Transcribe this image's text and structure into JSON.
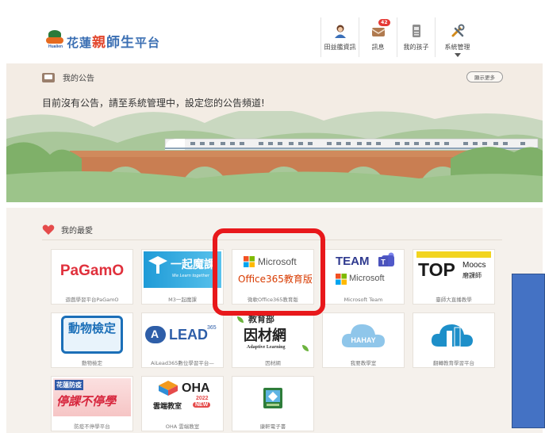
{
  "header": {
    "logo": {
      "text1": "花蓮",
      "text2": "親",
      "text3": "師生",
      "text4": "平台",
      "sub": "Hualien"
    },
    "nav": [
      {
        "label": "田益艦資訊",
        "icon": "user-icon"
      },
      {
        "label": "訊息",
        "icon": "mail-icon",
        "badge": "42"
      },
      {
        "label": "我的孩子",
        "icon": "student-card-icon"
      },
      {
        "label": "系統管理",
        "icon": "tools-icon"
      }
    ]
  },
  "announce": {
    "title": "我的公告",
    "more": "顯示更多",
    "text": "目前沒有公告，請至系統管理中，設定您的公告頻道!"
  },
  "favorites": {
    "title": "我的最愛",
    "tiles": [
      {
        "caption": "遊戲學習平台PaGamO",
        "logo": "PaGamO"
      },
      {
        "caption": "M3一起魔課",
        "logo": "一起魔課",
        "logo_sub": "We Learn together"
      },
      {
        "caption": "微軟Office365教育版",
        "logo_top": "Microsoft",
        "logo_bottom": "Office365教育版"
      },
      {
        "caption": "Microsoft Team",
        "logo_top": "TEAM",
        "logo_bottom": "Microsoft"
      },
      {
        "caption": "臺師大直播教學",
        "logo": "TOP",
        "logo_side_top": "Moocs",
        "logo_side_bottom": "磨課師"
      },
      {
        "caption": "動物檢定",
        "logo": "動物檢定"
      },
      {
        "caption": "AiLead365數位學習平台—",
        "logo": "LEAD",
        "logo_sup": "365"
      },
      {
        "caption": "因材網",
        "logo_top": "教育部",
        "logo": "因材網",
        "logo_sub": "Adaptive Learning"
      },
      {
        "caption": "我要教學室",
        "logo": "HAHAY"
      },
      {
        "caption": "翻轉教育學習平台",
        "logo": ""
      },
      {
        "caption": "防疫不停學平台",
        "logo_top": "花蓮防疫",
        "logo": "停課不停學"
      },
      {
        "caption": "OHA 雲端教室",
        "logo": "OHA",
        "logo_sub": "雲端教室",
        "logo_year": "2022",
        "logo_new": "NEW"
      },
      {
        "caption": "康軒電子書",
        "logo": ""
      }
    ]
  },
  "colors": {
    "highlight_box": "#e8181b",
    "blue_box": "#4472c4"
  }
}
